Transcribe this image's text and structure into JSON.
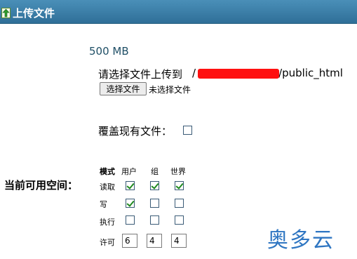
{
  "window": {
    "title": "上传文件",
    "icon": "upload-arrow-icon"
  },
  "quota": "500 MB",
  "upload": {
    "label": "请选择文件上传到",
    "path_prefix": "/",
    "path_suffix": "/public_html",
    "choose_button": "选择文件",
    "file_status": "未选择文件"
  },
  "overwrite": {
    "label": "覆盖现有文件：",
    "checked": false
  },
  "space": {
    "label": "当前可用空间："
  },
  "permissions": {
    "headers": {
      "mode": "模式",
      "user": "用户",
      "group": "组",
      "world": "世界"
    },
    "rows": [
      {
        "label": "读取",
        "user": true,
        "group": true,
        "world": true
      },
      {
        "label": "写",
        "user": true,
        "group": false,
        "world": false
      },
      {
        "label": "执行",
        "user": false,
        "group": false,
        "world": false
      }
    ],
    "octal_label": "许可",
    "octal": {
      "user": "6",
      "group": "4",
      "world": "4"
    }
  },
  "watermark": "奥多云",
  "colors": {
    "titlebar": "#2f6f98",
    "check": "#1f8a1f",
    "redaction": "#ff1010",
    "watermark": "#2f76c2"
  }
}
